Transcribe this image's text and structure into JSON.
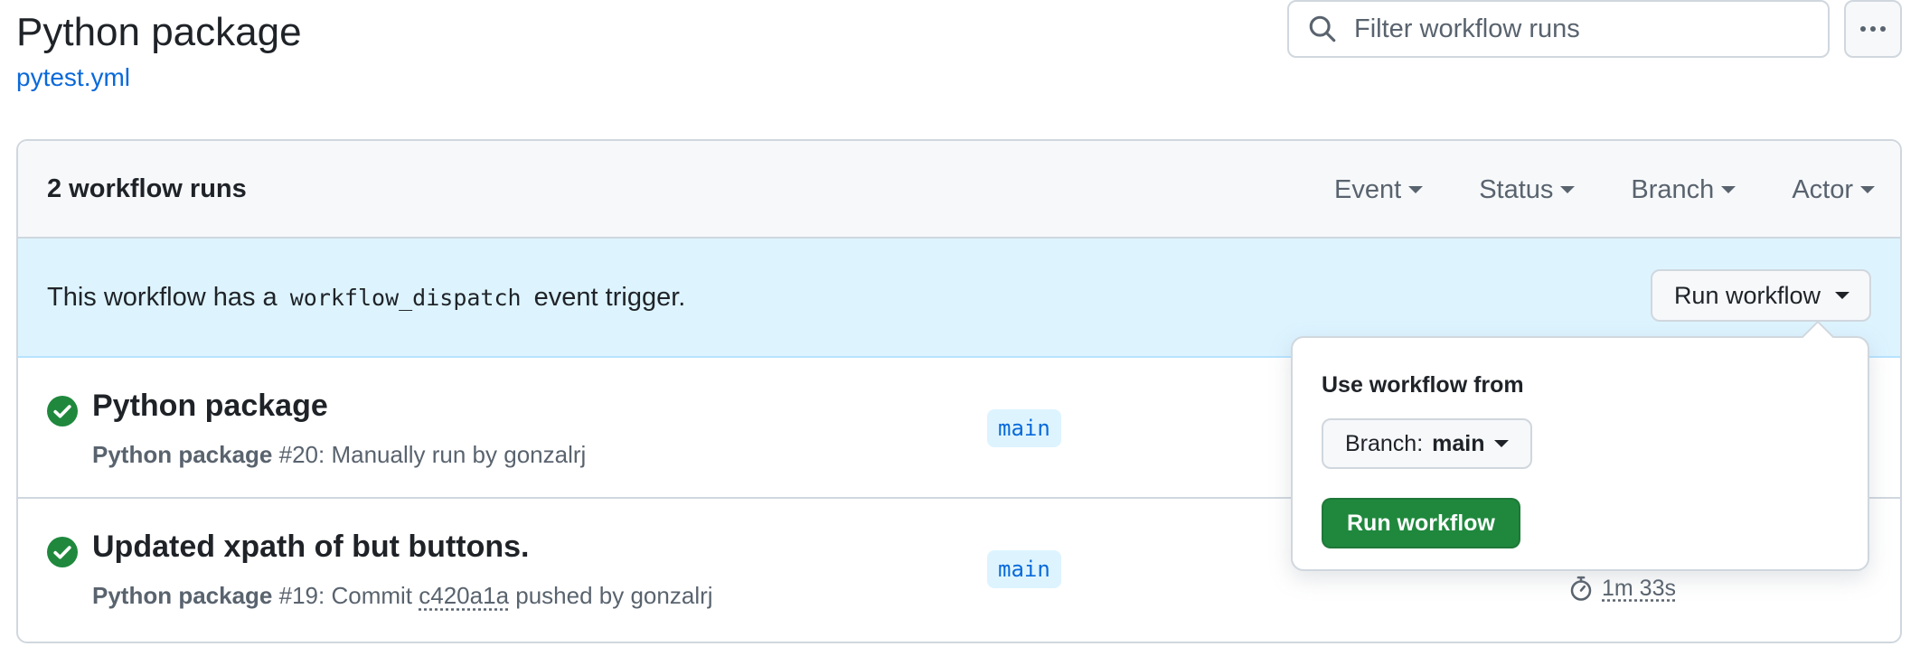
{
  "header": {
    "title": "Python package",
    "workflow_file": "pytest.yml"
  },
  "search": {
    "placeholder": "Filter workflow runs"
  },
  "list": {
    "count_label": "2 workflow runs",
    "filters": [
      "Event",
      "Status",
      "Branch",
      "Actor"
    ]
  },
  "dispatch": {
    "prefix": "This workflow has a",
    "code": "workflow_dispatch",
    "suffix": "event trigger.",
    "button_label": "Run workflow"
  },
  "runs": [
    {
      "title": "Python package",
      "workflow": "Python package",
      "number": "#20",
      "detail": ": Manually run by gonzalrj",
      "branch": "main",
      "status": "success"
    },
    {
      "title": "Updated xpath of but buttons.",
      "workflow": "Python package",
      "number": "#19",
      "detail_pre": ": Commit",
      "commit": "c420a1a",
      "detail_post": "pushed by gonzalrj",
      "branch": "main",
      "duration": "1m 33s",
      "status": "success"
    }
  ],
  "popover": {
    "label": "Use workflow from",
    "branch_prefix": "Branch:",
    "branch_value": "main",
    "run_button": "Run workflow"
  },
  "colors": {
    "accent": "#0969da",
    "success": "#1f883d",
    "info_bg": "#ddf4ff"
  }
}
